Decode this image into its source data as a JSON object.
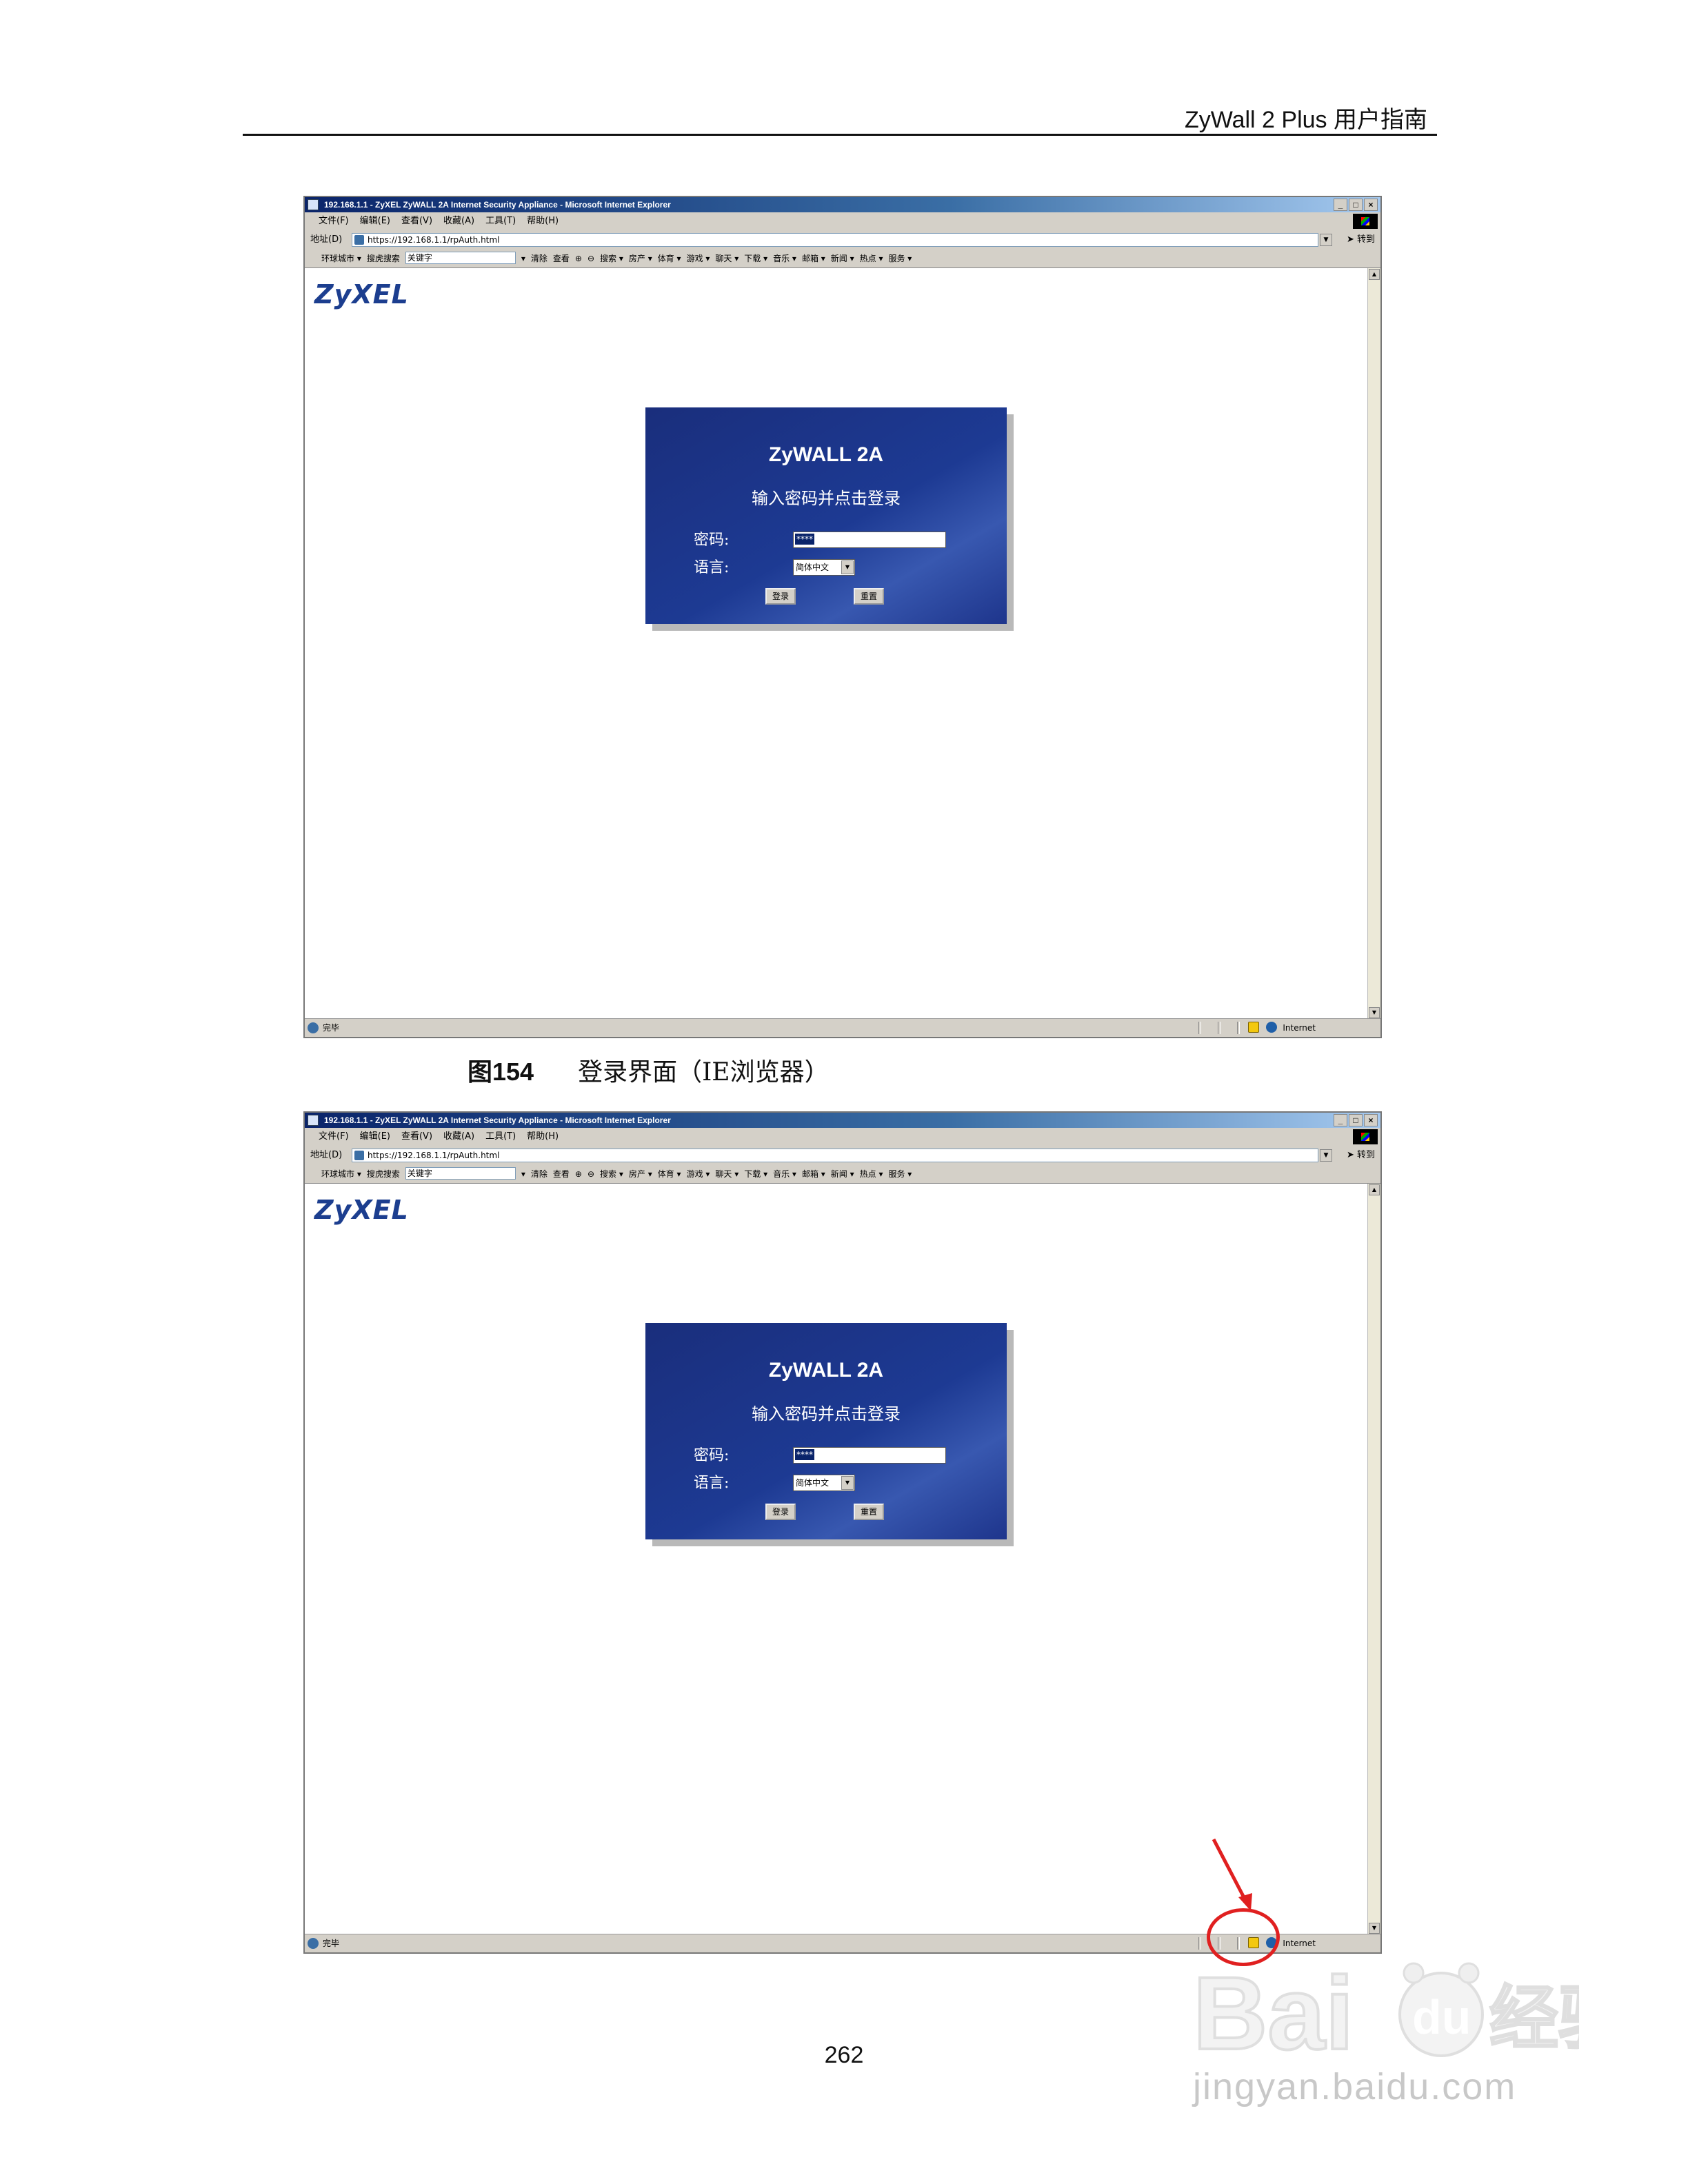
{
  "page_header": {
    "title": "ZyWall 2 Plus 用户指南"
  },
  "browser": {
    "window_title": "192.168.1.1 - ZyXEL ZyWALL 2A Internet Security Appliance - Microsoft Internet Explorer",
    "window_buttons": [
      "_",
      "□",
      "×"
    ],
    "menu_items": [
      "文件(F)",
      "编辑(E)",
      "查看(V)",
      "收藏(A)",
      "工具(T)",
      "帮助(H)"
    ],
    "address_label": "地址(D)",
    "address_url": "https://192.168.1.1/rpAuth.html",
    "go_label": "转到",
    "links_toolbar": [
      "环球城市 ▾",
      "搜虎搜索",
      "关键字",
      "▾",
      "清除",
      "查看",
      "⊕",
      "⊖",
      "搜索 ▾",
      "房产 ▾",
      "体育 ▾",
      "游戏 ▾",
      "聊天 ▾",
      "下载 ▾",
      "音乐 ▾",
      "邮箱 ▾",
      "新闻 ▾",
      "热点 ▾",
      "服务 ▾"
    ],
    "status_text": "完毕",
    "zone_text": "Internet"
  },
  "webpage": {
    "logo_text": "ZyXEL",
    "login": {
      "title": "ZyWALL 2A",
      "prompt": "输入密码并点击登录",
      "password_label": "密码:",
      "password_value": "****",
      "language_label": "语言:",
      "language_value": "简体中文",
      "login_button": "登录",
      "reset_button": "重置"
    }
  },
  "caption": {
    "figure_number": "图154",
    "text": "登录界面（IE浏览器）"
  },
  "page_number": "262",
  "watermark": {
    "brand": "Baidu经验",
    "url": "jingyan.baidu.com"
  },
  "colors": {
    "login_panel": "#1d3a93",
    "annotation": "#e02020",
    "logo": "#1c3e8f"
  }
}
